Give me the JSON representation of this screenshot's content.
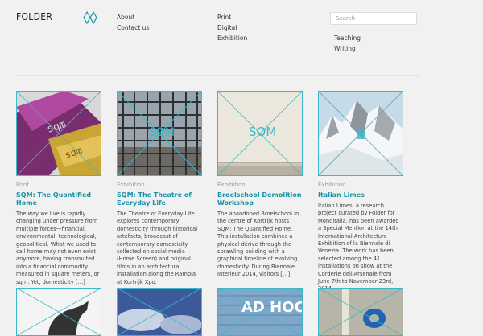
{
  "header": {
    "logo": "FOLDER",
    "nav_primary": [
      "About",
      "Contact us"
    ],
    "nav_secondary": [
      "Print",
      "Digital",
      "Exhibition"
    ],
    "search_placeholder": "Search",
    "nav_tertiary": [
      "Teaching",
      "Writing"
    ]
  },
  "colors": {
    "accent": "#1a93a8",
    "frame": "#3cb8c8",
    "background": "#f1f1f1"
  },
  "cards": [
    {
      "category": "Print",
      "title": "SQM: The Quantified Home",
      "description": "The way we live is rapidly changing under pressure from multiple forces—financial, environmental, technological, geopolitical. What we used to call home may not even exist anymore, having transmuted into a financial commodity measured in square meters, or sqm. Yet, domesticity […]"
    },
    {
      "category": "Exhibition",
      "title": "SQM: The Theatre of Everyday Life",
      "description": "The Theatre of Everyday Life explores contemporary domesticity through historical artefacts, broadcast of contemporary domesticity collected on social media (Home Screen) and original films in an architectural installation along the Rambla at Kortrijk Xpo."
    },
    {
      "category": "Exhibition",
      "title": "Broelschool Demolition Workshop",
      "description": "The abandoned Broelschool in the centre of Kortrijk hosts SQM: The Quantified Home. This installation combines a physical dérive through the sprawling building with a graphical timeline of evolving domesticity. During Biennale Interieur 2014, visitors […]"
    },
    {
      "category": "Exhibition",
      "title": "Italian Limes",
      "description": "Italian Limes, a research project curated by Folder for Monditalia, has been awarded a Special Mention at the 14th International Architecture Exhibition of la Biennale di Venezia. The work has been selected among the 41 installations on show at the Corderie dell'Arsenale from June 7th to November 23rd, 2014."
    }
  ],
  "thumb_texts": {
    "sqm": "SQM",
    "adhoc": "AD HOC"
  }
}
